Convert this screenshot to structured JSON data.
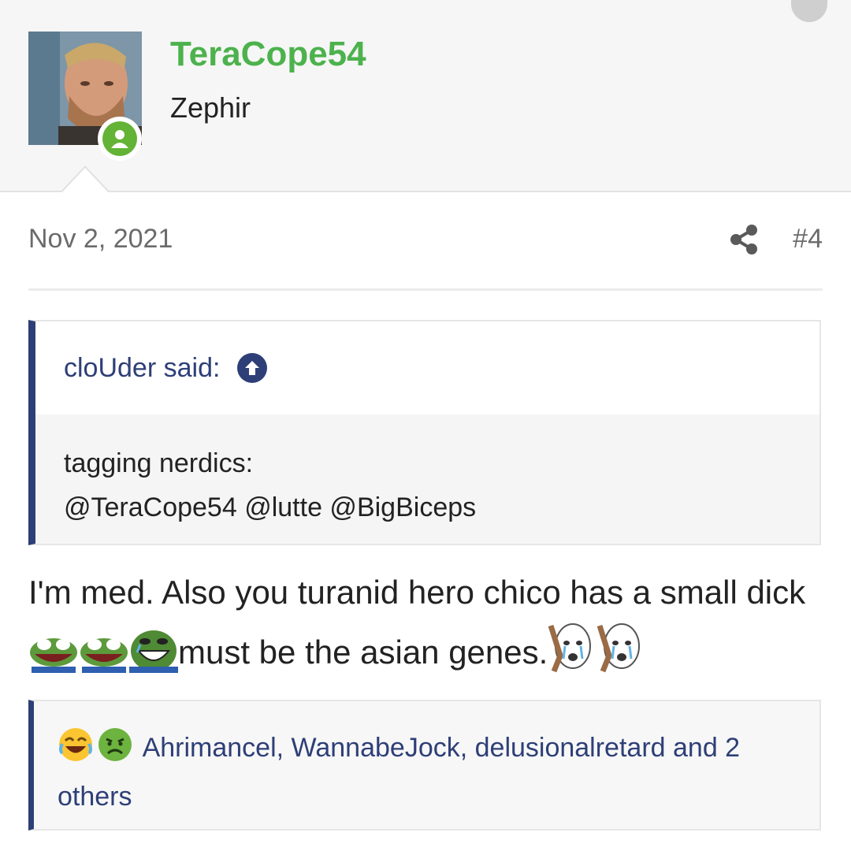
{
  "post": {
    "author": {
      "username": "TeraCope54",
      "user_title": "Zephir",
      "online": true,
      "username_color": "#4db24d"
    },
    "date": "Nov 2, 2021",
    "post_number": "#4",
    "quote": {
      "author_said": "cloUder said:",
      "line1": "tagging nerdics:",
      "line2": "@TeraCope54 @lutte @BigBiceps"
    },
    "message": {
      "part1": "I'm med. Also you turanid hero chico has a small dick",
      "part2": "must be the asian genes."
    },
    "reactions": {
      "text": "Ahrimancel, WannabeJock, delusionalretard and 2 others",
      "emojis": [
        "crying-laughing-emoji",
        "sick-face-emoji"
      ]
    }
  },
  "colors": {
    "accent": "#2e3f77",
    "online": "#63b336"
  }
}
